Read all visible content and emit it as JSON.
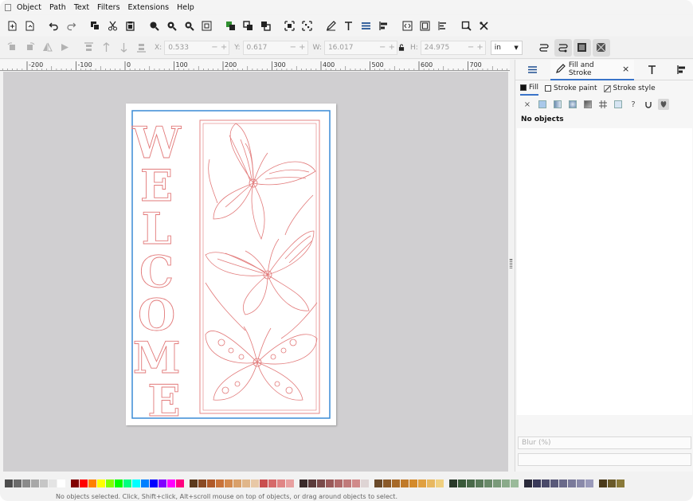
{
  "menu": {
    "items": [
      "Object",
      "Path",
      "Text",
      "Filters",
      "Extensions",
      "Help"
    ]
  },
  "commandbar": {
    "icons": [
      "new-document-icon",
      "open-document-icon",
      "undo-icon",
      "redo-icon",
      "copy-icon",
      "cut-icon",
      "paste-icon",
      "zoom-selection-icon",
      "zoom-drawing-icon",
      "zoom-page-icon",
      "zoom-1to1-icon",
      "duplicate-icon",
      "clone-icon",
      "unlink-clone-icon",
      "group-icon",
      "ungroup-icon",
      "xml-editor-icon",
      "text-font-icon",
      "layers-icon",
      "align-icon",
      "xml-icon",
      "document-properties-icon",
      "swatches-icon",
      "find-icon",
      "preferences-icon"
    ]
  },
  "controlbar": {
    "x_label": "X:",
    "x_value": "0.533",
    "y_label": "Y:",
    "y_value": "0.617",
    "w_label": "W:",
    "w_value": "16.017",
    "h_label": "H:",
    "h_value": "24.975",
    "unit": "in"
  },
  "ruler": {
    "labels": [
      "-200",
      "-100",
      "0",
      "100",
      "200",
      "300",
      "400",
      "500",
      "600",
      "700"
    ]
  },
  "panel": {
    "tab_title": "Fill and Stroke",
    "close_glyph": "×",
    "fill_tabs": [
      "Fill",
      "Stroke paint",
      "Stroke style"
    ],
    "paint_types": [
      "×",
      "?"
    ],
    "status": "No objects",
    "blur_label": "Blur (%)"
  },
  "palette": {
    "colors": [
      "#4d4d4d",
      "#6b6b6b",
      "#8a8a8a",
      "#a8a8a8",
      "#c6c6c6",
      "#e4e4e4",
      "#ffffff",
      "#800000",
      "#ff0000",
      "#ff8000",
      "#ffff00",
      "#80ff00",
      "#00ff00",
      "#00ff80",
      "#00ffff",
      "#0080ff",
      "#0000ff",
      "#8000ff",
      "#ff00ff",
      "#ff0080",
      "#5c3a1e",
      "#8a4a24",
      "#b05a2a",
      "#c9733a",
      "#d48a4f",
      "#d9a06a",
      "#e0b68a",
      "#e8c8a6",
      "#c94f4f",
      "#d66a6a",
      "#e08585",
      "#e8a0a0",
      "#3a2a2a",
      "#5a3a3a",
      "#7a4a4a",
      "#9a5a5a",
      "#b06a6a",
      "#c07a7a",
      "#d08a8a",
      "#ded4d4",
      "#6a4a2a",
      "#8a5a2a",
      "#a66a2a",
      "#c07a2a",
      "#d48a2a",
      "#e0a040",
      "#e8b860",
      "#f0d080",
      "#2a3a2a",
      "#3a5a3a",
      "#4a6a4a",
      "#5a7a5a",
      "#6a8a6a",
      "#7a9a7a",
      "#8aaa8a",
      "#9aba9a",
      "#2a2a3a",
      "#3a3a5a",
      "#4a4a6a",
      "#5a5a7a",
      "#6a6a8a",
      "#7a7a9a",
      "#8a8aaa",
      "#9a9aba",
      "#4a3a1a",
      "#6a5a2a",
      "#8a7a3a"
    ]
  },
  "statusbar": {
    "text": "No objects selected. Click, Shift+click, Alt+scroll mouse on top of objects, or drag around objects to select."
  },
  "artwork": {
    "word": "WELCOME",
    "accent": "#3a8bd6",
    "line_color": "#e27a7a"
  }
}
